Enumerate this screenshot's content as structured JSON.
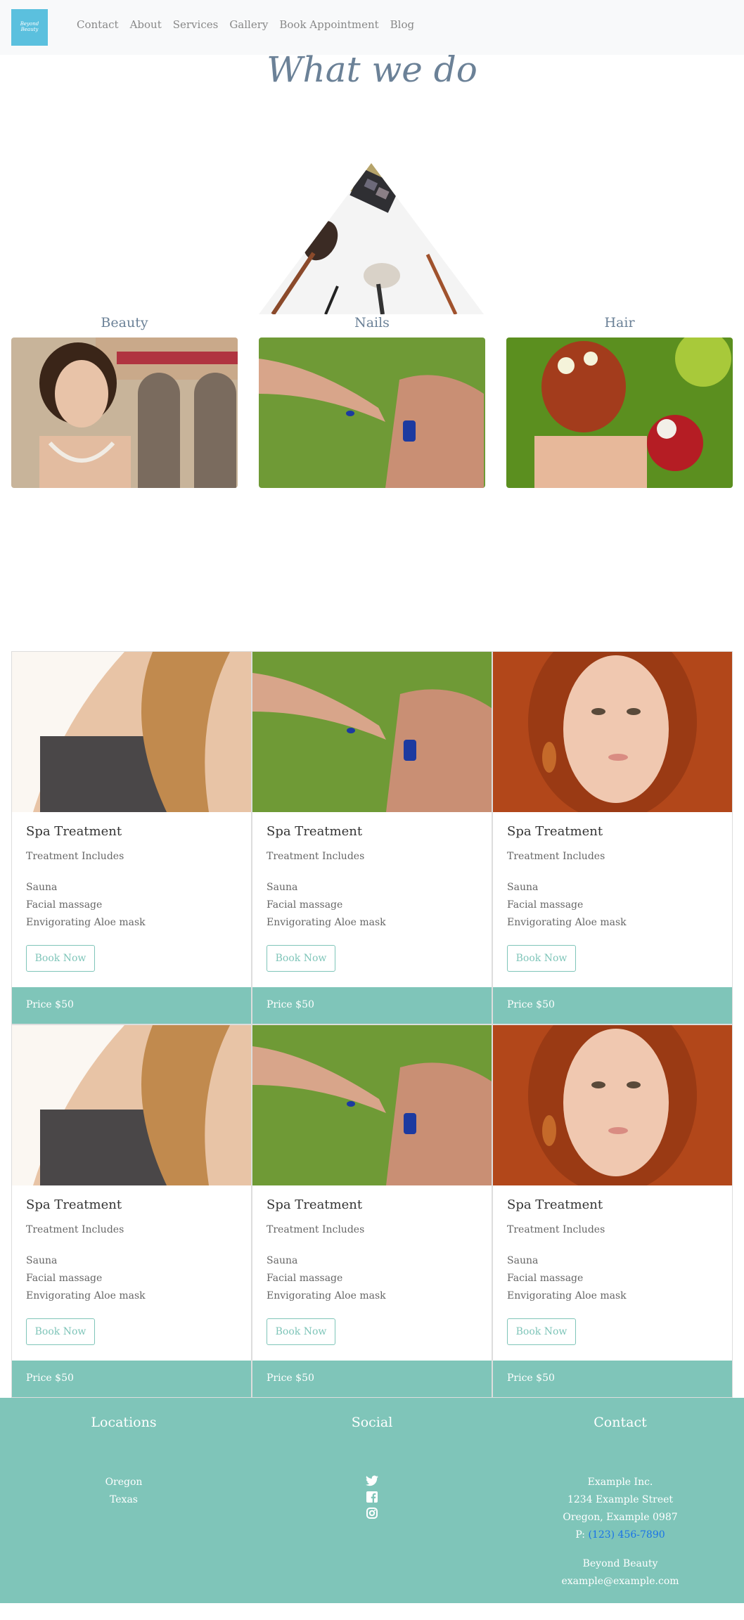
{
  "nav": {
    "logo_text": "Beyond Beauty",
    "links": [
      "Contact",
      "About",
      "Services",
      "Gallery",
      "Book Appointment",
      "Blog"
    ]
  },
  "hero": {
    "title": "What we do",
    "categories": [
      "Beauty",
      "Nails",
      "Hair"
    ]
  },
  "cards": [
    {
      "title": "Spa Treatment",
      "subtitle": "Treatment Includes",
      "items": [
        "Sauna",
        "Facial massage",
        "Envigorating Aloe mask"
      ],
      "button": "Book Now",
      "price": "Price $50"
    },
    {
      "title": "Spa Treatment",
      "subtitle": "Treatment Includes",
      "items": [
        "Sauna",
        "Facial massage",
        "Envigorating Aloe mask"
      ],
      "button": "Book Now",
      "price": "Price $50"
    },
    {
      "title": "Spa Treatment",
      "subtitle": "Treatment Includes",
      "items": [
        "Sauna",
        "Facial massage",
        "Envigorating Aloe mask"
      ],
      "button": "Book Now",
      "price": "Price $50"
    },
    {
      "title": "Spa Treatment",
      "subtitle": "Treatment Includes",
      "items": [
        "Sauna",
        "Facial massage",
        "Envigorating Aloe mask"
      ],
      "button": "Book Now",
      "price": "Price $50"
    },
    {
      "title": "Spa Treatment",
      "subtitle": "Treatment Includes",
      "items": [
        "Sauna",
        "Facial massage",
        "Envigorating Aloe mask"
      ],
      "button": "Book Now",
      "price": "Price $50"
    },
    {
      "title": "Spa Treatment",
      "subtitle": "Treatment Includes",
      "items": [
        "Sauna",
        "Facial massage",
        "Envigorating Aloe mask"
      ],
      "button": "Book Now",
      "price": "Price $50"
    }
  ],
  "footer": {
    "locations": {
      "heading": "Locations",
      "items": [
        "Oregon",
        "Texas"
      ]
    },
    "social": {
      "heading": "Social",
      "icons": [
        "twitter-icon",
        "facebook-icon",
        "instagram-icon"
      ]
    },
    "contact": {
      "heading": "Contact",
      "company": "Example Inc.",
      "street": "1234 Example Street",
      "city": "Oregon, Example 0987",
      "phone_prefix": "P:",
      "phone": "(123) 456-7890",
      "brand": "Beyond Beauty",
      "email": "example@example.com"
    }
  },
  "colors": {
    "accent": "#7fc5b9",
    "logo_bg": "#5bc0de",
    "heading": "#6b8197"
  }
}
